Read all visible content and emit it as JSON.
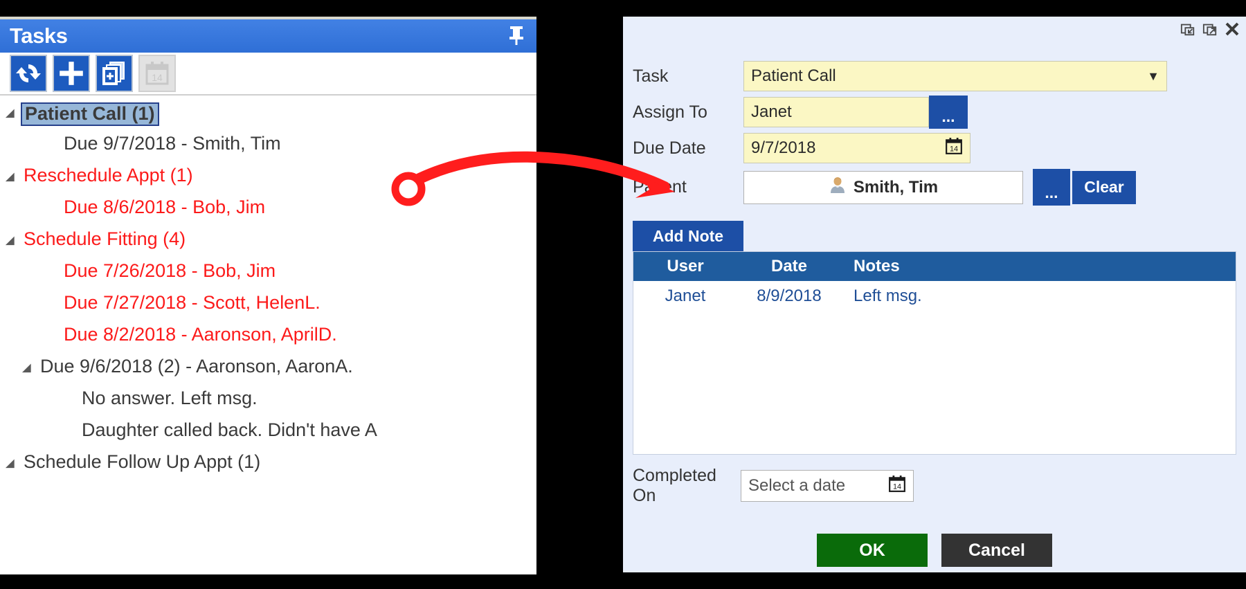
{
  "tasks_panel": {
    "title": "Tasks",
    "pin_icon": "pin-icon",
    "toolbar": [
      {
        "name": "refresh-button",
        "icon": "refresh-icon",
        "enabled": true
      },
      {
        "name": "add-task-button",
        "icon": "plus-icon",
        "enabled": true
      },
      {
        "name": "add-multiple-tasks-button",
        "icon": "copy-add-icon",
        "enabled": true
      },
      {
        "name": "calendar-button",
        "icon": "calendar-14-icon",
        "enabled": false
      }
    ],
    "tree": [
      {
        "level": 1,
        "expander": true,
        "text": "Patient Call (1)",
        "color": "dark",
        "bold": true,
        "selected": true
      },
      {
        "level": 2,
        "expander": false,
        "text": "Due 9/7/2018 - Smith, Tim",
        "color": "dark",
        "bold": false,
        "selected": false
      },
      {
        "level": 1,
        "expander": true,
        "text": "Reschedule Appt (1)",
        "color": "red",
        "bold": false,
        "selected": false
      },
      {
        "level": 2,
        "expander": false,
        "text": "Due 8/6/2018 - Bob, Jim",
        "color": "red",
        "bold": false,
        "selected": false
      },
      {
        "level": 1,
        "expander": true,
        "text": "Schedule Fitting (4)",
        "color": "red",
        "bold": false,
        "selected": false
      },
      {
        "level": 2,
        "expander": false,
        "text": "Due 7/26/2018 - Bob, Jim",
        "color": "red",
        "bold": false,
        "selected": false
      },
      {
        "level": 2,
        "expander": false,
        "text": "Due 7/27/2018 - Scott, HelenL.",
        "color": "red",
        "bold": false,
        "selected": false
      },
      {
        "level": 2,
        "expander": false,
        "text": "Due 8/2/2018 - Aaronson, AprilD.",
        "color": "red",
        "bold": false,
        "selected": false
      },
      {
        "level": 2,
        "expander": true,
        "text": "Due 9/6/2018 (2) - Aaronson, AaronA.",
        "color": "dark",
        "bold": false,
        "selected": false
      },
      {
        "level": 3,
        "expander": false,
        "text": "No answer. Left msg.",
        "color": "dark",
        "bold": false,
        "selected": false
      },
      {
        "level": 3,
        "expander": false,
        "text": "Daughter called back. Didn't have A",
        "color": "dark",
        "bold": false,
        "selected": false
      },
      {
        "level": 1,
        "expander": true,
        "text": "Schedule Follow Up Appt (1)",
        "color": "dark",
        "bold": false,
        "selected": false
      }
    ]
  },
  "dialog": {
    "window_controls": [
      {
        "name": "restore-down-icon",
        "label": "restore-down"
      },
      {
        "name": "pop-out-icon",
        "label": "pop-out"
      },
      {
        "name": "close-icon",
        "label": "✕"
      }
    ],
    "fields": {
      "task": {
        "label": "Task",
        "value": "Patient Call",
        "dropdown_glyph": "▼"
      },
      "assign_to": {
        "label": "Assign To",
        "value": "Janet",
        "browse_label": "..."
      },
      "due_date": {
        "label": "Due Date",
        "value": "9/7/2018",
        "calendar_icon": "calendar-14-icon"
      },
      "patient": {
        "label": "Patient",
        "value": "Smith, Tim",
        "avatar_icon": "person-icon",
        "browse_label": "...",
        "clear_label": "Clear"
      },
      "completed_on": {
        "label": "Completed On",
        "value": "",
        "placeholder": "Select a date",
        "calendar_icon": "calendar-14-icon"
      }
    },
    "add_note_label": "Add Note",
    "notes_table": {
      "columns": [
        "User",
        "Date",
        "Notes"
      ],
      "rows": [
        {
          "user": "Janet",
          "date": "8/9/2018",
          "notes": "Left msg."
        }
      ]
    },
    "footer": {
      "ok_label": "OK",
      "cancel_label": "Cancel"
    }
  },
  "annotation": {
    "type": "red-arrow",
    "color": "#FF1D1D",
    "description": "curved arrow from Smith, Tim in task list to Patient field in dialog"
  },
  "colors": {
    "panel_title_blue": "#3A7AE0",
    "toolbar_blue": "#1D5BBF",
    "dialog_bg": "#E8EEFB",
    "yellow_field": "#FBF7C4",
    "table_header_blue": "#1F5C9E",
    "overdue_red": "#FC1A1A",
    "ok_green": "#0A6B0A",
    "cancel_dark": "#333333",
    "annotation_red": "#FF1D1D"
  }
}
